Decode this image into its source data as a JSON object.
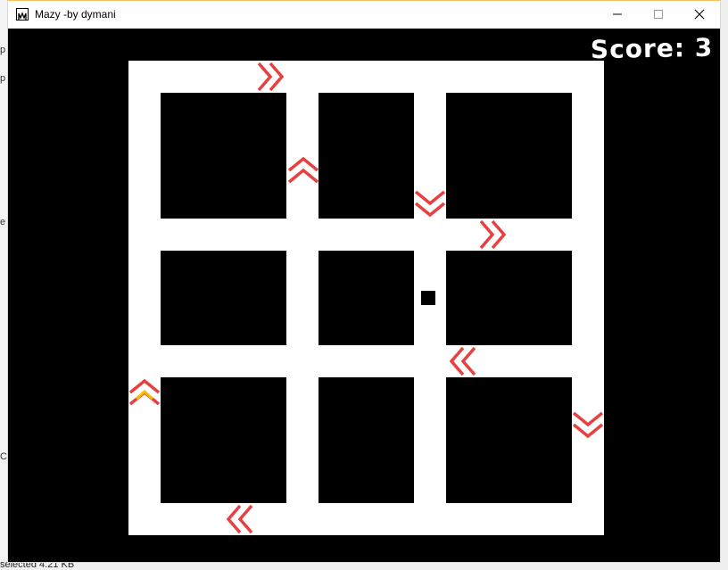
{
  "window": {
    "title": "Mazy -by dymani"
  },
  "background_app": {
    "fragments": [
      "p",
      "p",
      "e",
      "C:"
    ],
    "status_text": "selected  4.21 KB"
  },
  "game": {
    "score_label": "Score:",
    "score_value": "3",
    "score_text": "Score: 3",
    "colors": {
      "background": "#000000",
      "path": "#ffffff",
      "walls": "#000000",
      "arrow": "#e84040",
      "arrow_highlight": "#f5c000",
      "player": "#000000"
    },
    "grid": {
      "rows": 3,
      "cols": 3
    },
    "arrows": [
      {
        "direction": "right",
        "highlighted": false
      },
      {
        "direction": "up",
        "highlighted": false
      },
      {
        "direction": "down",
        "highlighted": false
      },
      {
        "direction": "right",
        "highlighted": false
      },
      {
        "direction": "left",
        "highlighted": false
      },
      {
        "direction": "up",
        "highlighted": true
      },
      {
        "direction": "down",
        "highlighted": false
      },
      {
        "direction": "left",
        "highlighted": false
      }
    ]
  }
}
